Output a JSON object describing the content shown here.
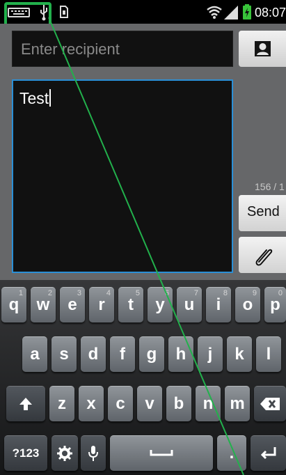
{
  "status_bar": {
    "time": "08:07",
    "icons": [
      "keyboard-icon",
      "usb-icon",
      "sim-icon",
      "wifi-icon",
      "signal-icon",
      "battery-charging-icon"
    ]
  },
  "compose": {
    "recipient_placeholder": "Enter recipient",
    "message_text": "Test",
    "counter": "156 / 1",
    "send_label": "Send",
    "contact_icon": "contact-icon",
    "attach_icon": "paperclip-icon"
  },
  "keyboard": {
    "row1": [
      {
        "label": "q",
        "hint": "1"
      },
      {
        "label": "w",
        "hint": "2"
      },
      {
        "label": "e",
        "hint": "3"
      },
      {
        "label": "r",
        "hint": "4"
      },
      {
        "label": "t",
        "hint": "5"
      },
      {
        "label": "y",
        "hint": "6"
      },
      {
        "label": "u",
        "hint": "7"
      },
      {
        "label": "i",
        "hint": "8"
      },
      {
        "label": "o",
        "hint": "9"
      },
      {
        "label": "p",
        "hint": "0"
      }
    ],
    "row2": [
      "a",
      "s",
      "d",
      "f",
      "g",
      "h",
      "j",
      "k",
      "l"
    ],
    "row3": [
      "z",
      "x",
      "c",
      "v",
      "b",
      "n",
      "m"
    ],
    "symbols_label": "?123",
    "period_label": ".",
    "icons": [
      "shift-icon",
      "backspace-icon",
      "settings-icon",
      "microphone-icon",
      "spacebar-icon",
      "enter-icon"
    ]
  },
  "colors": {
    "highlight": "#22b14c",
    "focus_border": "#2b8fd6",
    "compose_background": "#666769"
  }
}
